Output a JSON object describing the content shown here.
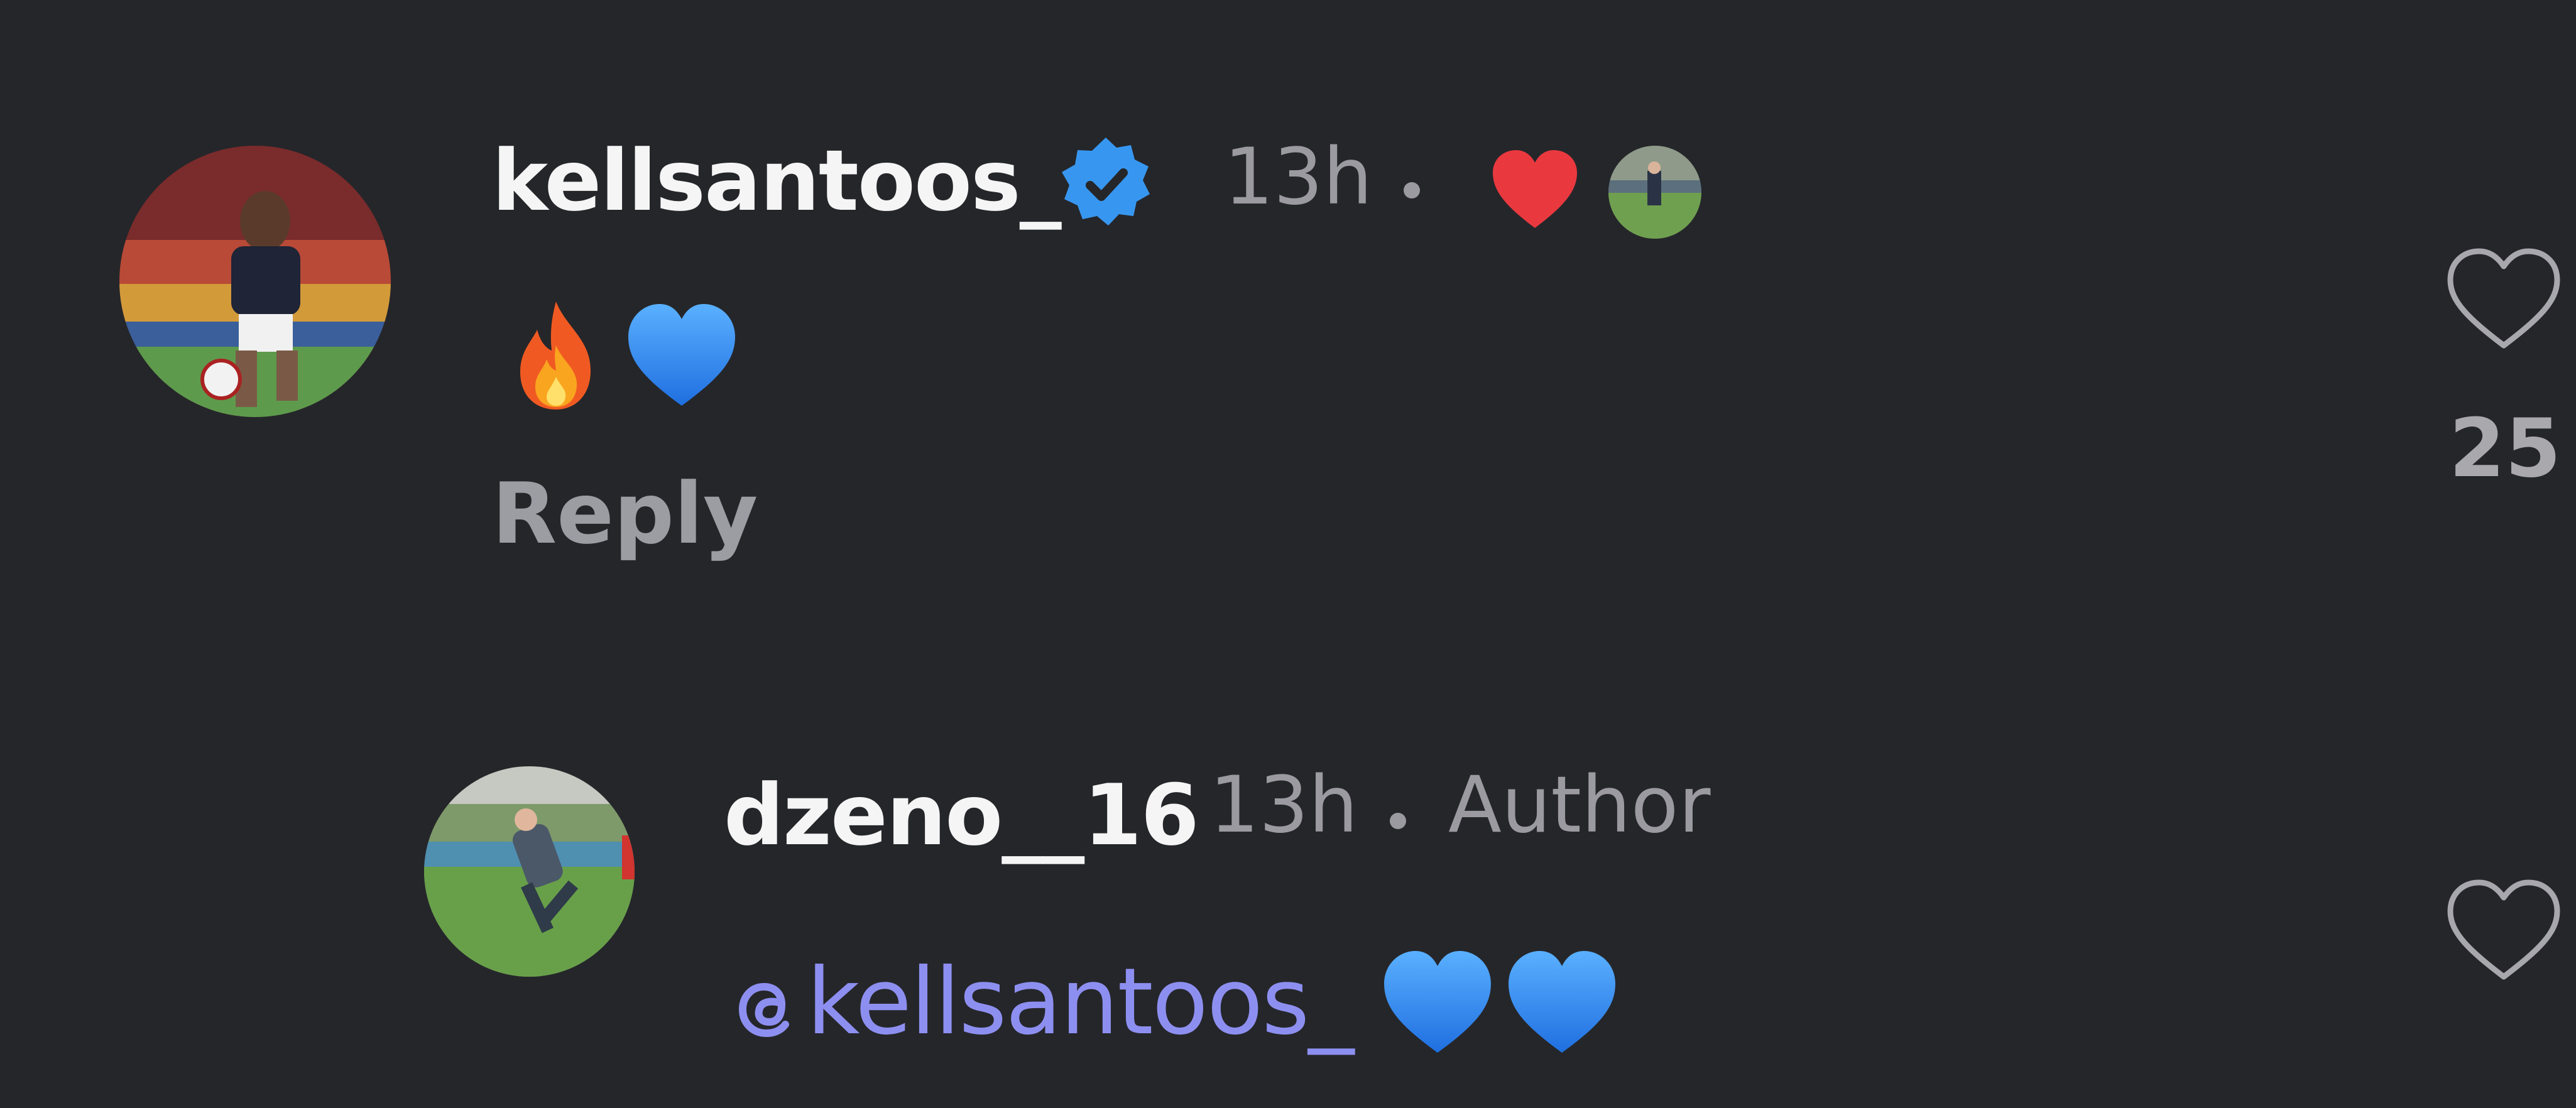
{
  "comments": [
    {
      "username": "kellsantoos_",
      "verified": true,
      "time": "13h",
      "liked_by_author": true,
      "body_emojis": [
        "fire-emoji",
        "blue-heart-emoji"
      ],
      "reply_label": "Reply",
      "like_count": "25"
    },
    {
      "username": "dzeno__16",
      "time": "13h",
      "badge": "Author",
      "mention": "kellsantoos_",
      "body_emojis": [
        "blue-heart-emoji",
        "blue-heart-emoji"
      ]
    }
  ],
  "colors": {
    "background": "#25262a",
    "username": "#f5f5f5",
    "muted": "#9a9aa0",
    "mention": "#8d8ff0",
    "liked_heart": "#e9393f",
    "verified_badge": "#3797f0",
    "blue_heart": "#2f8df0"
  }
}
